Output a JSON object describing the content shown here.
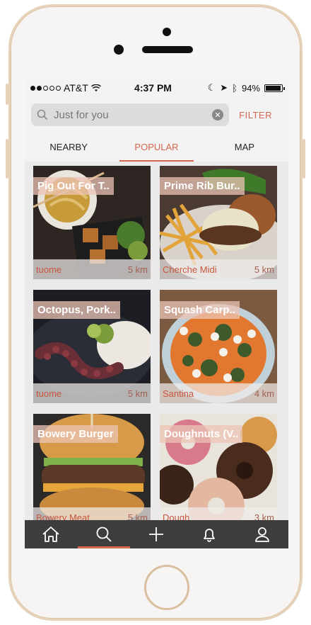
{
  "status_bar": {
    "carrier": "AT&T",
    "time": "4:37 PM",
    "battery": "94%"
  },
  "search": {
    "placeholder": "Just for you",
    "filter_label": "FILTER"
  },
  "tabs": [
    {
      "label": "NEARBY",
      "active": false
    },
    {
      "label": "POPULAR",
      "active": true
    },
    {
      "label": "MAP",
      "active": false
    }
  ],
  "cards": [
    {
      "title": "Pig Out For T..",
      "place": "tuome",
      "distance": "5 km"
    },
    {
      "title": "Prime Rib Bur..",
      "place": "Cherche Midi",
      "distance": "5 km"
    },
    {
      "title": "Octopus, Pork..",
      "place": "tuome",
      "distance": "5 km"
    },
    {
      "title": "Squash Carp..",
      "place": "Santina",
      "distance": "4 km"
    },
    {
      "title": "Bowery Burger",
      "place": "Bowery Meat",
      "distance": "5 km"
    },
    {
      "title": "Doughnuts (V..",
      "place": "Dough",
      "distance": "3 km"
    }
  ],
  "tabbar": [
    {
      "icon": "home-icon",
      "active": false
    },
    {
      "icon": "search-icon",
      "active": true
    },
    {
      "icon": "plus-icon",
      "active": false
    },
    {
      "icon": "bell-icon",
      "active": false
    },
    {
      "icon": "user-icon",
      "active": false
    }
  ],
  "colors": {
    "accent": "#d4664e",
    "tabbar_bg": "#3d3d3d",
    "frame_gold": "#e6d2b8"
  }
}
